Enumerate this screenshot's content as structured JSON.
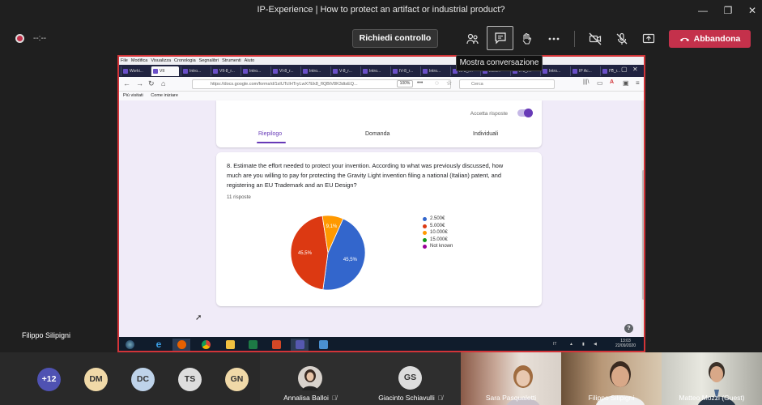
{
  "window": {
    "title": "IP-Experience | How to protect an artifact or industrial product?",
    "minimize": "—",
    "maximize": "❐",
    "close": "✕"
  },
  "toolbar": {
    "timer": "--:--",
    "request_control": "Richiedi controllo",
    "leave": "Abbandona",
    "tooltip": "Mostra conversazione",
    "colors": {
      "leave": "#c4314b",
      "record": "#c4314b"
    }
  },
  "browser": {
    "menu": [
      "File",
      "Modifica",
      "Visualizza",
      "Cronologia",
      "Segnalibri",
      "Strumenti",
      "Aiuto"
    ],
    "tabs": [
      "Worki...",
      "VII",
      "Intro...",
      "VII-8_r...",
      "Intro...",
      "VI-8_r...",
      "Intro...",
      "V-8_r...",
      "Intro...",
      "IV-8_r...",
      "Intro...",
      "III-8_r...",
      "Intro...",
      "II-8_r...",
      "Intro...",
      "IP Ac...",
      "I-8_r..."
    ],
    "url": "https://docs.google.com/forms/d/1sIUTcIHTryLwX7Ek8_fIQBtV8K3dtsEQ...",
    "zoom": "100%",
    "search_placeholder": "Cerca",
    "bookmarks": [
      "Più visitati",
      "Come iniziare"
    ]
  },
  "form": {
    "accept_label": "Accetta risposte",
    "tabs": [
      "Riepilogo",
      "Domanda",
      "Individuali"
    ],
    "question": "8. Estimate the effort needed to protect your invention. According to what was previously discussed, how much are you willing to pay for protecting the Gravity Light invention filing a national (Italian) patent, and registering an EU Trademark and an EU Design?",
    "responses": "11 risposte",
    "help": "?"
  },
  "chart_data": {
    "type": "pie",
    "categories": [
      "2.500€",
      "5.000€",
      "10.000€",
      "15.000€",
      "Not known"
    ],
    "values": [
      45.5,
      45.5,
      9.1,
      0,
      0
    ],
    "slice_labels": [
      "45,5%",
      "45,5%",
      "9,1%",
      "",
      ""
    ],
    "colors": [
      "#3366cc",
      "#dc3912",
      "#ff9900",
      "#109618",
      "#990099"
    ],
    "legend_position": "right"
  },
  "taskbar": {
    "lang": "IT",
    "time": "13:03",
    "date": "22/09/2020"
  },
  "presenter": {
    "name": "Filippo Silipigni"
  },
  "participants": {
    "more": "+12",
    "avatars": [
      {
        "initials": "DM",
        "color": "#f0d9a8"
      },
      {
        "initials": "DC",
        "color": "#bed3ea"
      },
      {
        "initials": "TS",
        "color": "#dddddd"
      },
      {
        "initials": "GN",
        "color": "#f0d9a8"
      }
    ],
    "tiles": [
      {
        "name": "Annalisa Balloi"
      },
      {
        "name": "Giacinto Schiavulli",
        "initials": "GS"
      },
      {
        "name": "Sara Pasqualetti"
      },
      {
        "name": "Filippo Silipigni"
      },
      {
        "name": "Matteo Mozzi (Guest)"
      }
    ]
  }
}
